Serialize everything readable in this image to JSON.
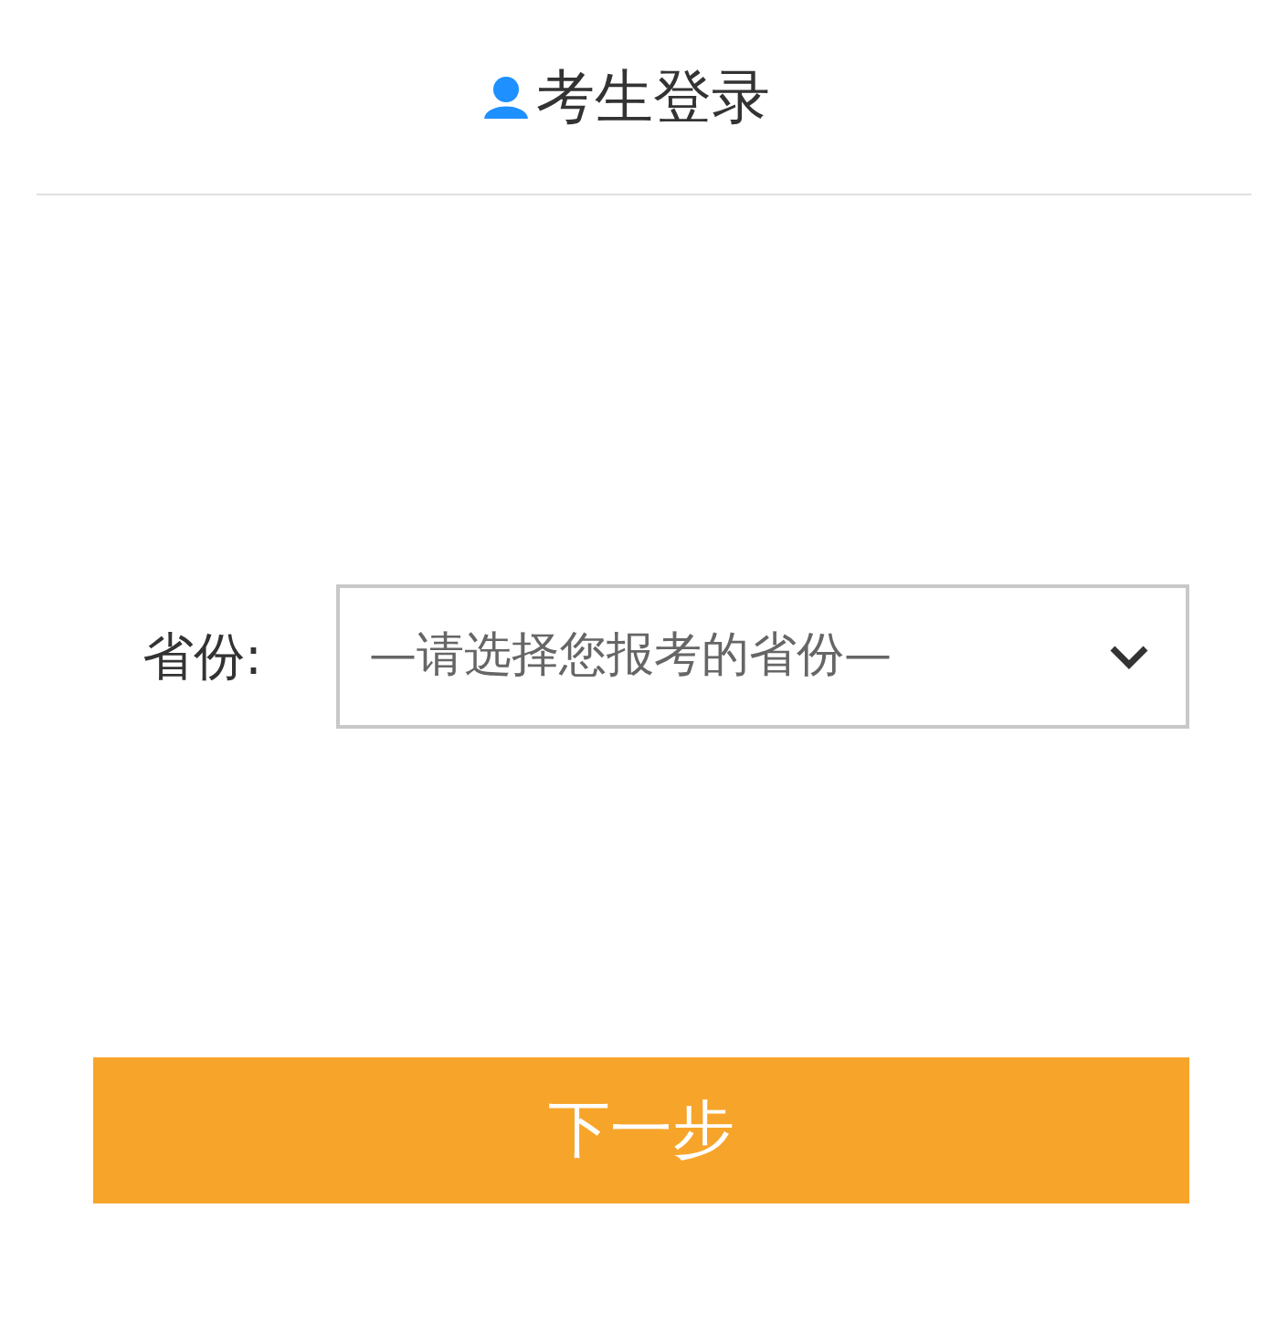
{
  "header": {
    "title": "考生登录"
  },
  "form": {
    "province": {
      "label": "省份:",
      "value": "—请选择您报考的省份—"
    }
  },
  "next_button": {
    "label": "下一步"
  }
}
